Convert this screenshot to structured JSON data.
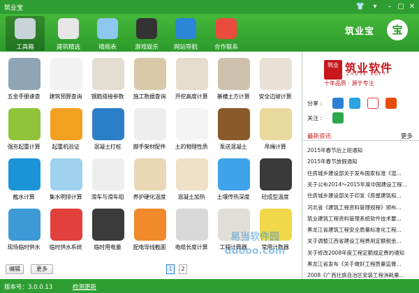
{
  "window": {
    "title": "筑业宝"
  },
  "window_controls": [
    "shirt-icon",
    "menu-icon",
    "minimize-icon",
    "maximize-icon",
    "close-icon"
  ],
  "nav": {
    "items": [
      {
        "label": "工具箱",
        "icon": "tools-icon",
        "color": "#c8d4d8",
        "active": true
      },
      {
        "label": "建筑精选",
        "icon": "magnifier-icon",
        "color": "#e7e7e7",
        "active": false
      },
      {
        "label": "晴雨表",
        "icon": "weather-icon",
        "color": "#8ec7ef",
        "active": false
      },
      {
        "label": "游戏娱乐",
        "icon": "gamepad-icon",
        "color": "#333333",
        "active": false
      },
      {
        "label": "网站导航",
        "icon": "ie-icon",
        "color": "#2b86d6",
        "active": false
      },
      {
        "label": "合作联系",
        "icon": "puzzle-icon",
        "color": "#e94c3d",
        "active": false
      }
    ],
    "logo_text": "筑业宝",
    "logo_mark": "宝"
  },
  "tools": [
    {
      "label": "五金手册速查",
      "icon": "hammer-icon",
      "color": "#8fa5b5"
    },
    {
      "label": "建筑预算查询",
      "icon": "magnifier-icon",
      "color": "#f2f2f2"
    },
    {
      "label": "钢筋搭接参数",
      "icon": "magnifier-icon",
      "color": "#e4ddd1"
    },
    {
      "label": "施工数据查询",
      "icon": "ruler-icon",
      "color": "#d9c9a8"
    },
    {
      "label": "开挖高度计算",
      "icon": "chart-icon",
      "color": "#e6dccc"
    },
    {
      "label": "基槽土方计算",
      "icon": "excavation-icon",
      "color": "#cfc2ad"
    },
    {
      "label": "安全边坡计算",
      "icon": "slope-icon",
      "color": "#e8e1d4"
    },
    {
      "label": "强夯起重计算",
      "icon": "crane-icon",
      "color": "#8fc43a"
    },
    {
      "label": "起重机验证",
      "icon": "helmet-icon",
      "color": "#f2a020"
    },
    {
      "label": "混凝土打桩",
      "icon": "pile-icon",
      "color": "#2b7fc6"
    },
    {
      "label": "脚手架材配件",
      "icon": "chain-icon",
      "color": "#eeeeee"
    },
    {
      "label": "土的物理性质",
      "icon": "wheelbarrow-icon",
      "color": "#f4f4f4"
    },
    {
      "label": "泵送混凝土",
      "icon": "pump-icon",
      "color": "#8b5a2b"
    },
    {
      "label": "吊绳计算",
      "icon": "rope-icon",
      "color": "#e9d99f"
    },
    {
      "label": "截水计算",
      "icon": "water-ring-icon",
      "color": "#1b95d8"
    },
    {
      "label": "集水明排计算",
      "icon": "drainage-icon",
      "color": "#9fd2ee"
    },
    {
      "label": "滑车与滑车组",
      "icon": "pulley-icon",
      "color": "#eeeeee"
    },
    {
      "label": "养护硬化温度",
      "icon": "thermometer-icon",
      "color": "#ead7b5"
    },
    {
      "label": "混凝土加热",
      "icon": "heap-icon",
      "color": "#efe0c7"
    },
    {
      "label": "土壤传热深度",
      "icon": "cube-icon",
      "color": "#3ea3e8"
    },
    {
      "label": "砼成型温度",
      "icon": "mixer-icon",
      "color": "#3a3a3a"
    },
    {
      "label": "现场临时供水",
      "icon": "drop-icon",
      "color": "#3d9ad6"
    },
    {
      "label": "临时供水系统",
      "icon": "valve-icon",
      "color": "#e2403d"
    },
    {
      "label": "临时用电量",
      "icon": "bulb-icon",
      "color": "#3b3b3b"
    },
    {
      "label": "配电导线截面",
      "icon": "wires-icon",
      "color": "#f08a2c"
    },
    {
      "label": "电缆长度计算",
      "icon": "cable-icon",
      "color": "#d9d9d9"
    },
    {
      "label": "工程计算器",
      "icon": "calculator-icon",
      "color": "#e1ded8"
    },
    {
      "label": "常用计数器",
      "icon": "counter-icon",
      "color": "#f0d84a"
    }
  ],
  "footer": {
    "edit": "编辑",
    "more": "更多",
    "pages": [
      "1",
      "2"
    ],
    "current_page": "1"
  },
  "brand": {
    "badge": "筑业",
    "name": "筑业软件",
    "en": "ZHUYE SOFT",
    "slogan": "十年品质 · 源于专注"
  },
  "share": {
    "label": "分享 :",
    "icons": [
      "star-icon",
      "qq-space-icon",
      "weibo-icon",
      "tencent-weibo-icon"
    ]
  },
  "follow": {
    "label": "关注 :",
    "icons": [
      "wechat-icon"
    ]
  },
  "news": {
    "title": "最新资讯",
    "more": "更多",
    "items": [
      "2015年春节后上班通知",
      "2015年春节放假通知",
      "住房城乡建设部关于发布国家标准《混...",
      "关于公布2014〜2015年度中国建设工程...",
      "住房城乡建设部关于印发《房屋建筑和...",
      "河北省《建筑工程资料管理规程》颁布...",
      "筑业建筑工程资料管理系统软件技术要...",
      "黑龙江省建筑工程安全质量标准化工程...",
      "关于调整江西省建设工程费用定额税金...",
      "关于修改2008年度工程定额规定费的通知",
      "黑龙江省发布《关于做好工程质量监督...",
      "2008《广西壮族自治区安装工程消耗量..."
    ]
  },
  "status": {
    "version": "版本号：3.0.0.13",
    "update": "检测更新"
  },
  "watermark": {
    "line1": "易当软件园",
    "line2": "ddooo.com"
  }
}
